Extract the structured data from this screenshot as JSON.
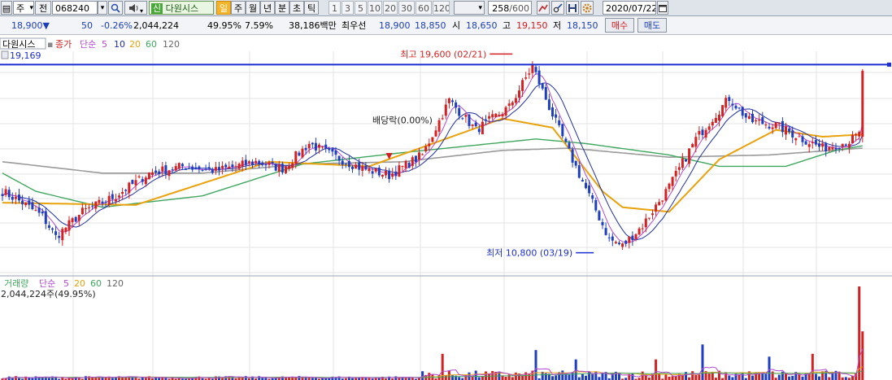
{
  "toolbar": {
    "market_select": "주",
    "market_caret": "▾",
    "mode_label": "전",
    "code_value": "068240",
    "code_caret": "▾",
    "search_icon": "magnifier",
    "sound_icon": "speaker",
    "sound_caret": "▾",
    "badge_letter": "신",
    "stock_name": "다원시스",
    "period_buttons": [
      "일",
      "주",
      "월",
      "년",
      "분",
      "초",
      "틱"
    ],
    "active_period": "일",
    "interval_buttons": [
      "1",
      "3",
      "5",
      "10",
      "20",
      "30",
      "60",
      "120"
    ],
    "range_caret": "▾",
    "view_count": "258",
    "view_total": "/600",
    "tool_icons": [
      "chart-tool-icon",
      "settings-tool-icon",
      "save-icon",
      "gear-icon"
    ],
    "date_value": "2020/07/22",
    "calendar_icon": "calendar"
  },
  "quote": {
    "price": "18,900",
    "change_arrow": "▼",
    "change": "50",
    "change_pct": "-0.26%",
    "volume": "2,044,224",
    "volume_ratio": "49.95%",
    "turnover": "7.59%",
    "amount": "38,186백만",
    "best_ask_label": "최우선",
    "best_ask": "18,900",
    "best_bid": "18,850",
    "open_label": "시",
    "open": "18,650",
    "high_label": "고",
    "high": "19,150",
    "low_label": "저",
    "low": "18,150",
    "buy_button": "매수",
    "sell_button": "매도"
  },
  "chart_data": {
    "type": "candlestick",
    "price_legend": {
      "name": "다원시스",
      "close_label": "종가",
      "ma_type": "단순",
      "ma_periods": [
        "5",
        "10",
        "20",
        "60",
        "120"
      ]
    },
    "price_axis_fragment": "19,169",
    "annotations": {
      "high": "최고 19,600 (02/21)",
      "low": "최저 10,800 (03/19)",
      "dividend": "배당락(0.00%)"
    },
    "volume_legend": {
      "name": "거래량",
      "ma_type": "단순",
      "ma_periods": [
        "5",
        "20",
        "60",
        "120"
      ],
      "last_value": "2,044,224주(49.95%)"
    },
    "colors": {
      "up": "#d42222",
      "down": "#1f3fbf",
      "ma5": "#b24ad0",
      "ma10": "#1f2f9f",
      "ma20": "#e8a20c",
      "ma60": "#3fa65f",
      "ma120": "#9a9a9a",
      "ref_line": "#1c2fcf"
    },
    "price_range": [
      10600,
      19900
    ],
    "reference_line": 19169,
    "anchors": [
      {
        "i": 0,
        "p": 13600
      },
      {
        "i": 6,
        "p": 13100
      },
      {
        "i": 12,
        "p": 12500
      },
      {
        "i": 16,
        "p": 11600
      },
      {
        "i": 24,
        "p": 12700
      },
      {
        "i": 34,
        "p": 13400
      },
      {
        "i": 44,
        "p": 14400
      },
      {
        "i": 54,
        "p": 14700
      },
      {
        "i": 64,
        "p": 14500
      },
      {
        "i": 76,
        "p": 14900
      },
      {
        "i": 84,
        "p": 14600
      },
      {
        "i": 92,
        "p": 15700
      },
      {
        "i": 100,
        "p": 15100
      },
      {
        "i": 108,
        "p": 14600
      },
      {
        "i": 116,
        "p": 14300
      },
      {
        "i": 126,
        "p": 15200
      },
      {
        "i": 134,
        "p": 17600
      },
      {
        "i": 142,
        "p": 16300
      },
      {
        "i": 152,
        "p": 17300
      },
      {
        "i": 159,
        "p": 19100
      },
      {
        "i": 164,
        "p": 17300
      },
      {
        "i": 170,
        "p": 15300
      },
      {
        "i": 176,
        "p": 13400
      },
      {
        "i": 182,
        "p": 11500
      },
      {
        "i": 186,
        "p": 11200
      },
      {
        "i": 192,
        "p": 12100
      },
      {
        "i": 200,
        "p": 13800
      },
      {
        "i": 208,
        "p": 15900
      },
      {
        "i": 214,
        "p": 17000
      },
      {
        "i": 218,
        "p": 17700
      },
      {
        "i": 224,
        "p": 16700
      },
      {
        "i": 232,
        "p": 16500
      },
      {
        "i": 240,
        "p": 15900
      },
      {
        "i": 246,
        "p": 15500
      },
      {
        "i": 254,
        "p": 15800
      },
      {
        "i": 257,
        "p": 16100
      },
      {
        "i": 258,
        "p": 18900
      }
    ],
    "ma_levels": {
      "ma20": [
        [
          0,
          13100
        ],
        [
          40,
          13000
        ],
        [
          80,
          14900
        ],
        [
          110,
          14700
        ],
        [
          150,
          16800
        ],
        [
          165,
          16400
        ],
        [
          180,
          13600
        ],
        [
          186,
          12900
        ],
        [
          200,
          12700
        ],
        [
          215,
          15000
        ],
        [
          232,
          16300
        ],
        [
          246,
          16000
        ],
        [
          258,
          16100
        ]
      ],
      "ma60": [
        [
          0,
          14400
        ],
        [
          10,
          13600
        ],
        [
          30,
          12900
        ],
        [
          60,
          13400
        ],
        [
          90,
          14800
        ],
        [
          120,
          15300
        ],
        [
          160,
          15900
        ],
        [
          175,
          15700
        ],
        [
          200,
          15200
        ],
        [
          215,
          14700
        ],
        [
          235,
          14700
        ],
        [
          250,
          15400
        ],
        [
          258,
          15600
        ]
      ],
      "ma120": [
        [
          0,
          14900
        ],
        [
          30,
          14400
        ],
        [
          60,
          14400
        ],
        [
          90,
          14800
        ],
        [
          120,
          14900
        ],
        [
          150,
          15400
        ],
        [
          170,
          15500
        ],
        [
          200,
          15100
        ],
        [
          230,
          15200
        ],
        [
          258,
          15500
        ]
      ]
    },
    "volume_spikes": [
      {
        "i": 132,
        "v": 0.28
      },
      {
        "i": 160,
        "v": 0.32
      },
      {
        "i": 172,
        "v": 0.22
      },
      {
        "i": 196,
        "v": 0.22
      },
      {
        "i": 210,
        "v": 0.38
      },
      {
        "i": 230,
        "v": 0.25
      },
      {
        "i": 243,
        "v": 0.28
      },
      {
        "i": 257,
        "v": 1.0
      },
      {
        "i": 258,
        "v": 0.52
      }
    ]
  }
}
